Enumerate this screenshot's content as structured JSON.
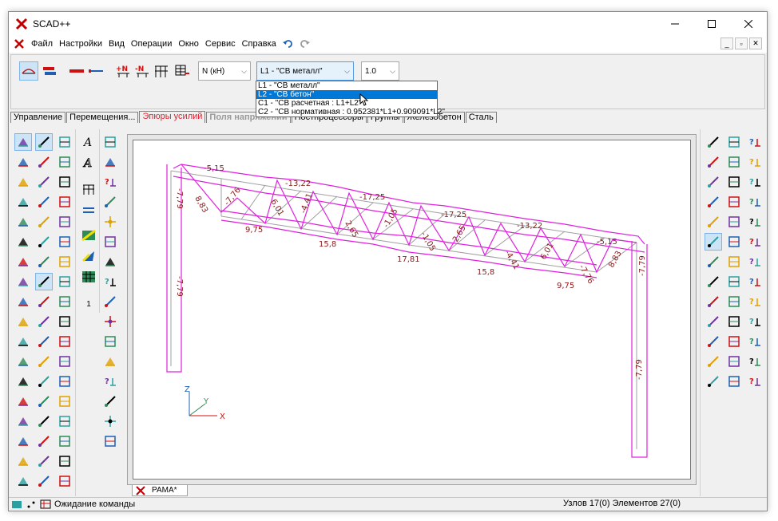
{
  "window": {
    "title": "SCAD++"
  },
  "menu": [
    "Файл",
    "Настройки",
    "Вид",
    "Операции",
    "Окно",
    "Сервис",
    "Справка"
  ],
  "toolbar": {
    "unit_combo": "N (кН)",
    "load_combo": "L1 - \"СВ металл\"",
    "scale_combo": "1.0",
    "load_options": [
      "L1 - \"СВ металл\"",
      "L2 - \"СВ бетон\"",
      "C1 - \"СВ расчетная : L1+L2\"",
      "C2 - \"СВ нормативная : 0.952381*L1+0.909091*L2\""
    ],
    "selected_option": 1
  },
  "tabs": [
    {
      "label": "Управление",
      "state": "normal"
    },
    {
      "label": "Перемещения...",
      "state": "normal"
    },
    {
      "label": "Эпюры усилий",
      "state": "active"
    },
    {
      "label": "Поля напряжений",
      "state": "disabled"
    },
    {
      "label": "Постпроцессоры",
      "state": "normal"
    },
    {
      "label": "Группы",
      "state": "normal"
    },
    {
      "label": "Железобетон",
      "state": "normal"
    },
    {
      "label": "Сталь",
      "state": "normal"
    }
  ],
  "mid_panel": {
    "counter": "1"
  },
  "doc_tab": {
    "label": "РАМА*"
  },
  "status": {
    "message": "Ожидание команды",
    "counts": "Узлов 17(0) Элементов 27(0)"
  },
  "axes": {
    "x": "X",
    "y": "Y",
    "z": "Z"
  },
  "colors": {
    "diagram": "#e020e0",
    "labels": "#8b1a1a",
    "frame": "#a0a0a0",
    "accent": "#0078d7"
  },
  "diagram_labels": [
    "-7,79",
    "-5,15",
    "8,83",
    "-7,76",
    "-13,22",
    "6,01",
    "-4,41",
    "-17,25",
    "2,65",
    "-1,05",
    "-17,25",
    "-1,05",
    "2,65",
    "-13,22",
    "-4,41",
    "6,01",
    "-5,15",
    "-7,76",
    "8,83",
    "9,75",
    "15,8",
    "17,81",
    "15,8",
    "9,75",
    "-7,79",
    "-7,79",
    "-7,79"
  ]
}
